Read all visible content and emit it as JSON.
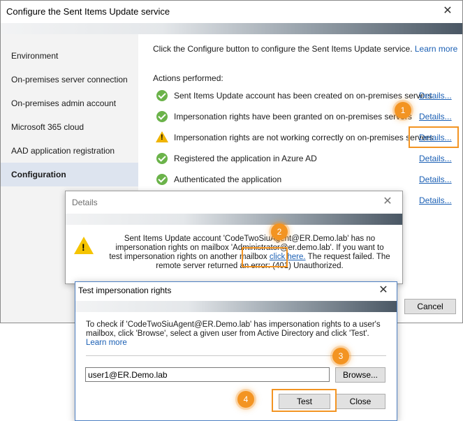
{
  "main": {
    "title": "Configure the Sent Items Update service",
    "sidebar": [
      {
        "label": "Environment"
      },
      {
        "label": "On-premises server connection"
      },
      {
        "label": "On-premises admin account"
      },
      {
        "label": "Microsoft 365 cloud"
      },
      {
        "label": "AAD application registration"
      },
      {
        "label": "Configuration"
      }
    ],
    "intro": "Click the Configure button to configure the Sent Items Update service.",
    "learn_more": "Learn more",
    "actions_heading": "Actions performed:",
    "actions": [
      {
        "status": "success",
        "text": "Sent Items Update account has been created on on-premises servers",
        "link": "Details..."
      },
      {
        "status": "success",
        "text": "Impersonation rights have been granted on on-premises servers",
        "link": "Details..."
      },
      {
        "status": "warning",
        "text": "Impersonation rights are not working correctly on on-premises servers",
        "link": "Details..."
      },
      {
        "status": "success",
        "text": "Registered the application in Azure AD",
        "link": "Details..."
      },
      {
        "status": "success",
        "text": "Authenticated the application",
        "link": "Details..."
      },
      {
        "status": "",
        "text": "",
        "link": "Details..."
      }
    ],
    "cancel_label": "Cancel"
  },
  "details_dialog": {
    "title": "Details",
    "msg_part1": "Sent Items Update account 'CodeTwoSiuAgent@ER.Demo.lab' has no impersonation rights on mailbox 'Administrator@er.demo.lab'. If you want to test impersonation rights on another mailbox",
    "link": "click here.",
    "msg_part2": "The request failed. The remote server returned an error: (401) Unauthorized."
  },
  "test_dialog": {
    "title": "Test impersonation rights",
    "instructions": "To check if 'CodeTwoSiuAgent@ER.Demo.lab' has impersonation rights to a user's mailbox, click 'Browse', select a given user from Active Directory and click 'Test'.",
    "learn_more": "Learn more",
    "mailbox_value": "user1@ER.Demo.lab",
    "browse_label": "Browse...",
    "test_label": "Test",
    "close_label": "Close"
  },
  "callouts": [
    "1",
    "2",
    "3",
    "4"
  ],
  "colors": {
    "accent": "#f39422",
    "link": "#1a5fb4",
    "success": "#6bb34a",
    "warning": "#f0b400"
  }
}
